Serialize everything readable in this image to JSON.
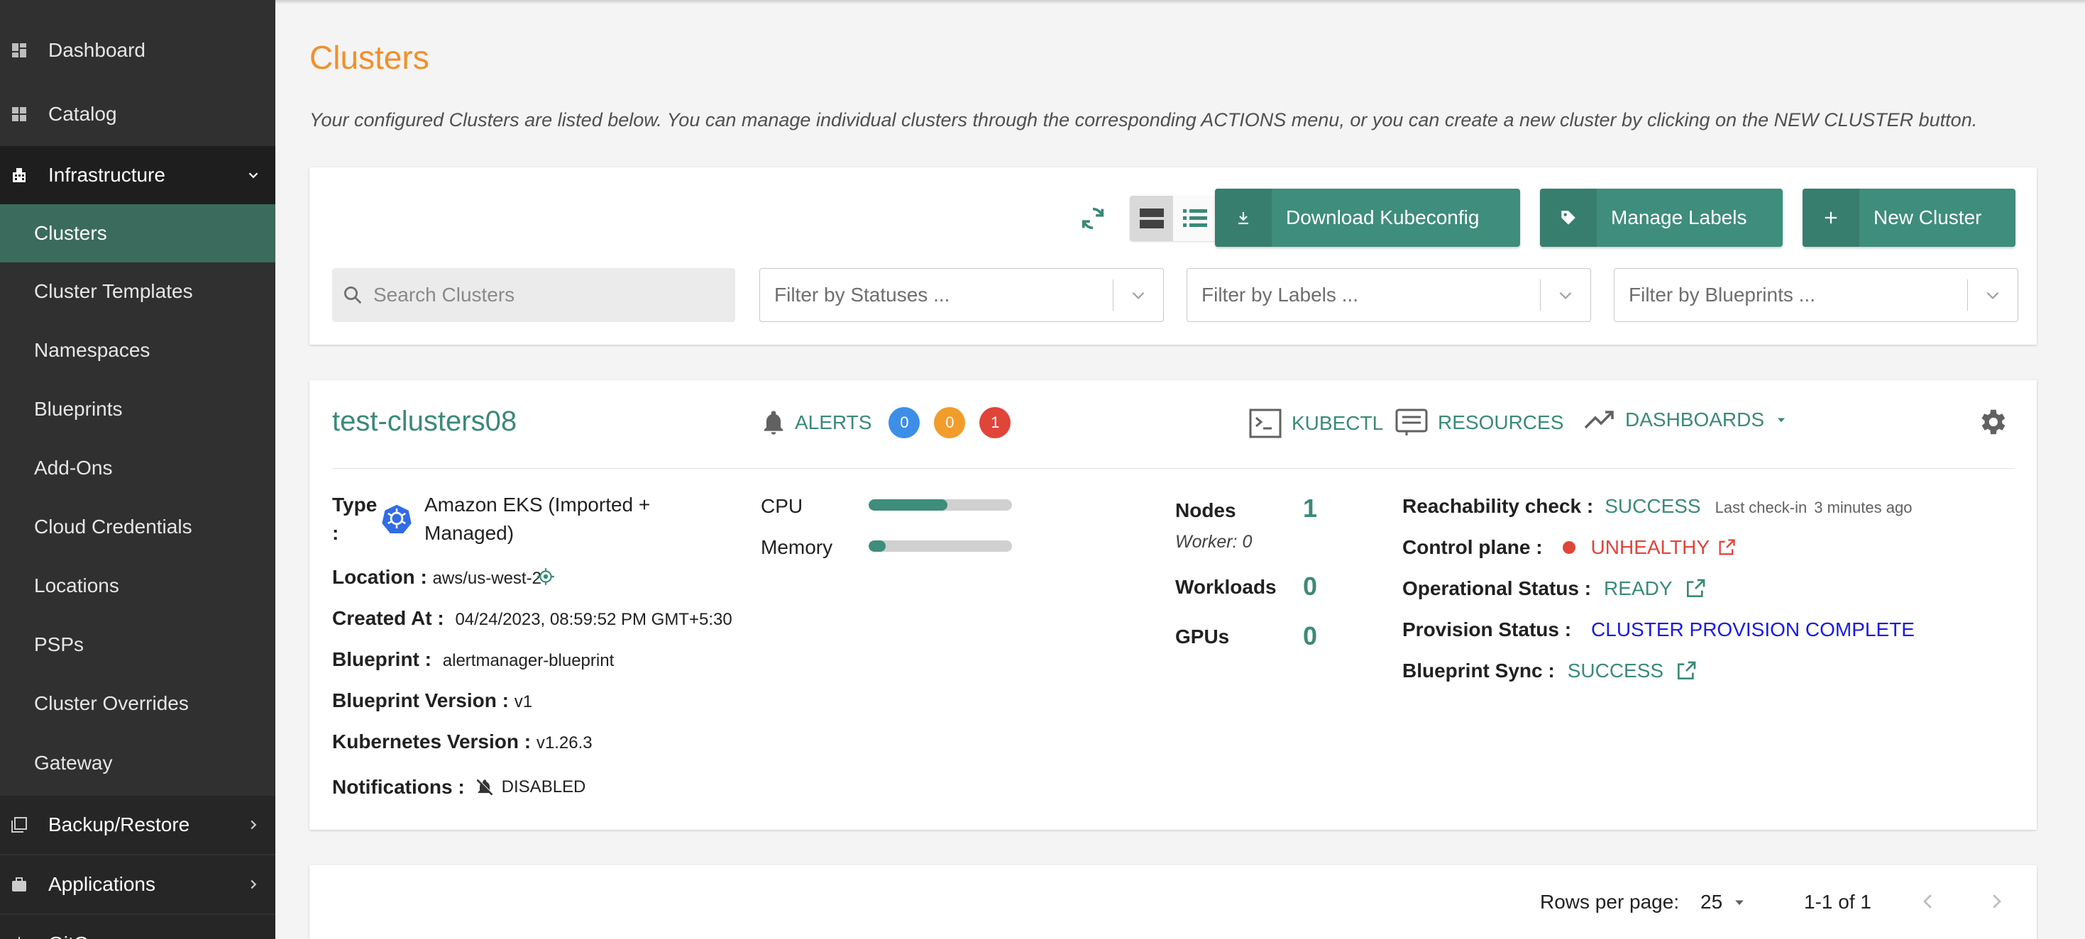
{
  "sidebar": {
    "items": [
      {
        "label": "Dashboard",
        "icon": "dashboard-icon"
      },
      {
        "label": "Catalog",
        "icon": "catalog-icon"
      },
      {
        "label": "Infrastructure",
        "icon": "infrastructure-icon"
      }
    ],
    "sub_items": [
      "Clusters",
      "Cluster Templates",
      "Namespaces",
      "Blueprints",
      "Add-Ons",
      "Cloud Credentials",
      "Locations",
      "PSPs",
      "Cluster Overrides",
      "Gateway"
    ],
    "bottom_items": [
      {
        "label": "Backup/Restore",
        "icon": "backup-icon"
      },
      {
        "label": "Applications",
        "icon": "briefcase-icon"
      },
      {
        "label": "GitO",
        "icon": "git-icon"
      }
    ],
    "active": "Clusters"
  },
  "page": {
    "title": "Clusters",
    "description": "Your configured Clusters are listed below. You can manage individual clusters through the corresponding ACTIONS menu, or you can create a new cluster by clicking on the NEW CLUSTER button."
  },
  "toolbar": {
    "download_label": "Download Kubeconfig",
    "labels_label": "Manage Labels",
    "new_label": "New Cluster",
    "search_placeholder": "Search Clusters",
    "filter_statuses": "Filter by Statuses ...",
    "filter_labels": "Filter by Labels ...",
    "filter_blueprints": "Filter by Blueprints ..."
  },
  "cluster": {
    "name": "test-clusters08",
    "alerts_label": "ALERTS",
    "alert_counts": [
      "0",
      "0",
      "1"
    ],
    "alert_colors": [
      "#3d8ee8",
      "#f29c2b",
      "#e0453a"
    ],
    "kubectl_label": "KUBECTL",
    "resources_label": "RESOURCES",
    "dashboards_label": "DASHBOARDS",
    "type_label": "Type",
    "type_colon": ":",
    "type_value_1": "Amazon EKS (Imported +",
    "type_value_2": "Managed)",
    "location_label": "Location :",
    "location_value": "aws/us-west-2",
    "created_label": "Created At :",
    "created_value": "04/24/2023, 08:59:52 PM GMT+5:30",
    "blueprint_label": "Blueprint :",
    "blueprint_value": "alertmanager-blueprint",
    "bp_version_label": "Blueprint Version :",
    "bp_version_value": "v1",
    "k8s_version_label": "Kubernetes Version :",
    "k8s_version_value": "v1.26.3",
    "notifications_label": "Notifications :",
    "notifications_value": "DISABLED",
    "cpu_label": "CPU",
    "cpu_usage": 0.55,
    "memory_label": "Memory",
    "memory_usage": 0.12,
    "nodes_label": "Nodes",
    "nodes_value": "1",
    "worker_label": "Worker: 0",
    "workloads_label": "Workloads",
    "workloads_value": "0",
    "gpus_label": "GPUs",
    "gpus_value": "0",
    "reach_label": "Reachability check :",
    "reach_value": "SUCCESS",
    "checkin_label": "Last check-in",
    "checkin_value": "3 minutes ago",
    "control_label": "Control plane :",
    "control_value": "UNHEALTHY",
    "op_label": "Operational Status :",
    "op_value": "READY",
    "prov_label": "Provision Status :",
    "prov_value": "CLUSTER PROVISION COMPLETE",
    "sync_label": "Blueprint Sync :",
    "sync_value": "SUCCESS"
  },
  "pager": {
    "rows_label": "Rows per page:",
    "rows_value": "25",
    "range": "1-1 of 1"
  },
  "colors": {
    "accent": "#3a8a78",
    "title": "#f0902a",
    "unhealthy": "#e0453a",
    "provision": "#1a1ae6"
  }
}
